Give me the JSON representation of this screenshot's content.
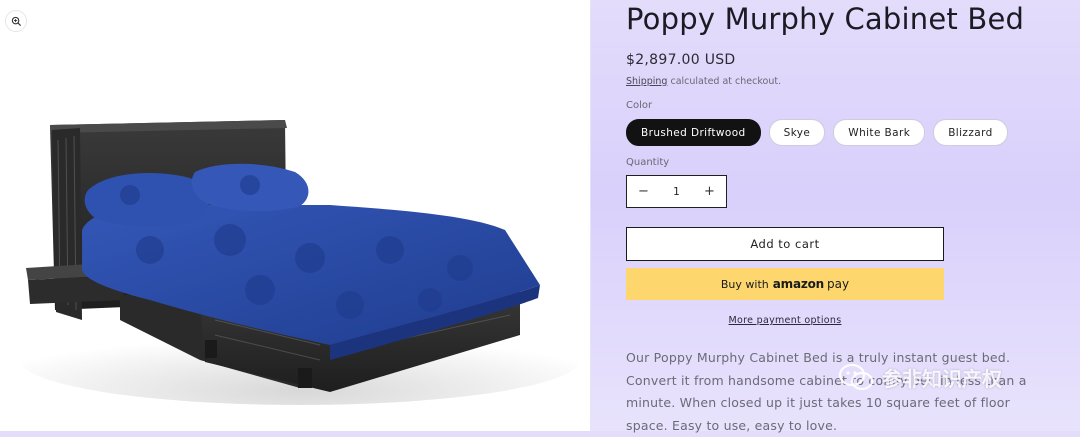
{
  "product": {
    "title": "Poppy Murphy Cabinet Bed",
    "price": "$2,897.00 USD",
    "shipping_link": "Shipping",
    "shipping_rest": " calculated at checkout.",
    "color_label": "Color",
    "colors": [
      "Brushed Driftwood",
      "Skye",
      "White Bark",
      "Blizzard"
    ],
    "selected_color": "Brushed Driftwood",
    "quantity_label": "Quantity",
    "quantity": "1",
    "minus": "−",
    "plus": "+",
    "add_to_cart": "Add to cart",
    "amazon_buy": "Buy with",
    "amazon_brand": "amazon",
    "amazon_pay": "pay",
    "more_payment": "More payment options",
    "description": "Our Poppy Murphy Cabinet Bed is a truly instant guest bed. Convert it from handsome cabinet to comfy bed in less than a minute. When closed up it just takes 10 square feet of floor space. Easy to use, easy to love."
  },
  "gallery": {
    "zoom_icon": "zoom-icon"
  },
  "watermark": {
    "text": "参非知识产权"
  },
  "colors": {
    "selected_swatch": "#121212",
    "amazon_button": "#fdd76e",
    "bedding": "#2d4fa6"
  }
}
